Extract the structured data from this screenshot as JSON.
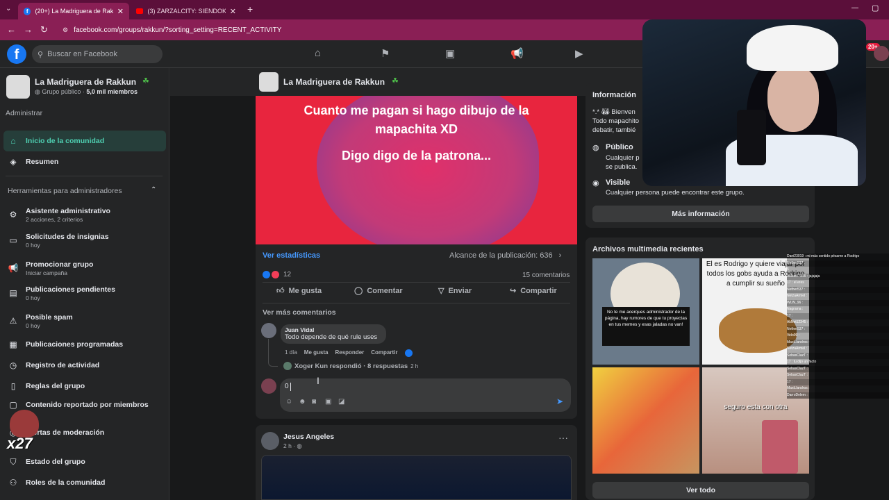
{
  "browser": {
    "tabs": [
      {
        "title": "(20+) La Madriguera de Rakkun",
        "active": true
      },
      {
        "title": "(3) ZARZALCITY: SIENDOKAM",
        "active": false
      }
    ],
    "url": "facebook.com/groups/rakkun/?sorting_setting=RECENT_ACTIVITY"
  },
  "header": {
    "search_placeholder": "Buscar en Facebook",
    "notif_badge": "20+"
  },
  "group": {
    "name": "La Madriguera de Rakkun",
    "meta_prefix": "Grupo público · ",
    "members": "5,0 mil miembros"
  },
  "sidebar": {
    "admin_label": "Administrar",
    "tools_heading": "Herramientas para administradores",
    "items": [
      {
        "label": "Inicio de la comunidad",
        "sub": "",
        "icon": "home-icon"
      },
      {
        "label": "Resumen",
        "sub": "",
        "icon": "layers-icon"
      },
      {
        "label": "Asistente administrativo",
        "sub": "2 acciones, 2 criterios",
        "icon": "gear-icon"
      },
      {
        "label": "Solicitudes de insignias",
        "sub": "0 hoy",
        "icon": "badge-icon"
      },
      {
        "label": "Promocionar grupo",
        "sub": "Iniciar campaña",
        "icon": "megaphone-icon"
      },
      {
        "label": "Publicaciones pendientes",
        "sub": "0 hoy",
        "icon": "pending-icon"
      },
      {
        "label": "Posible spam",
        "sub": "0 hoy",
        "icon": "warning-icon"
      },
      {
        "label": "Publicaciones programadas",
        "sub": "",
        "icon": "calendar-icon"
      },
      {
        "label": "Registro de actividad",
        "sub": "",
        "icon": "clock-icon"
      },
      {
        "label": "Reglas del grupo",
        "sub": "",
        "icon": "rules-icon"
      },
      {
        "label": "Contenido reportado por miembros",
        "sub": "",
        "icon": "report-icon"
      },
      {
        "label": "Alertas de moderación",
        "sub": "",
        "icon": "alert-icon"
      },
      {
        "label": "Estado del grupo",
        "sub": "",
        "icon": "shield-icon"
      },
      {
        "label": "Roles de la comunidad",
        "sub": "",
        "icon": "roles-icon"
      }
    ]
  },
  "post": {
    "banner_line1": "Cuanto me pagan si hago dibujo de la",
    "banner_line2": "mapachita XD",
    "banner_line3": "Digo digo de la patrona...",
    "stats_link": "Ver estadísticas",
    "reach": "Alcance de la publicación: 636",
    "reactions": "12",
    "comments": "15 comentarios",
    "actions": [
      "Me gusta",
      "Comentar",
      "Enviar",
      "Compartir"
    ],
    "more_comments": "Ver más comentarios",
    "comment": {
      "author": "Juan Vidal",
      "text": "Todo depende de qué rule uses",
      "time": "1 día",
      "like": "Me gusta",
      "reply": "Responder",
      "share": "Compartir"
    },
    "reply_summary": "Xoger Kun respondió · 8 respuestas",
    "reply_time": "2 h",
    "input_value": "0"
  },
  "post2": {
    "author": "Jesus Angeles",
    "time": "2 h ·"
  },
  "right": {
    "info_heading": "Información",
    "info_text1": "Bienven",
    "info_text2": "Todo mapachito",
    "info_text3": "debatir, tambié",
    "public_title": "Público",
    "public_text1": "Cualquier p",
    "public_text2": "se publica.",
    "visible_title": "Visible",
    "visible_text": "Cualquier persona puede encontrar este grupo.",
    "more_info": "Más información",
    "media_heading": "Archivos multimedia recientes",
    "media_captions": [
      "No te me acerques administrador de la página, hay rumores de que tu proyectas en tus memes y esas jaladas no van!",
      "El es Rodrigo y quiere viajar por todos los gobs ayuda a Rodrigo a cumplir su sueño",
      "",
      "seguro esta con otra"
    ],
    "see_all": "Ver todo"
  },
  "overlay": {
    "counter": "x27",
    "chat_lines": [
      "Dani23019 : mi más sentido pésame a Rodrigo",
      "Nether537 :",
      "5",
      "AkNet12345 : jajajaja",
      "17 : el eres",
      "Nether537 :",
      "NetzaArmel :",
      "WUN_96 :",
      "Nagrama :",
      "17 :",
      "AkNet12345 :",
      "Nether537 :",
      "Velo09 :",
      "MaxiLlandros :",
      "NetzaArmel :",
      "SebasClazT :",
      "17 : tu dijo un facto",
      "SebasClazT :",
      "SebasClazT :",
      "17 :",
      "MaxiLlandros :",
      "DarroDelem :"
    ]
  }
}
